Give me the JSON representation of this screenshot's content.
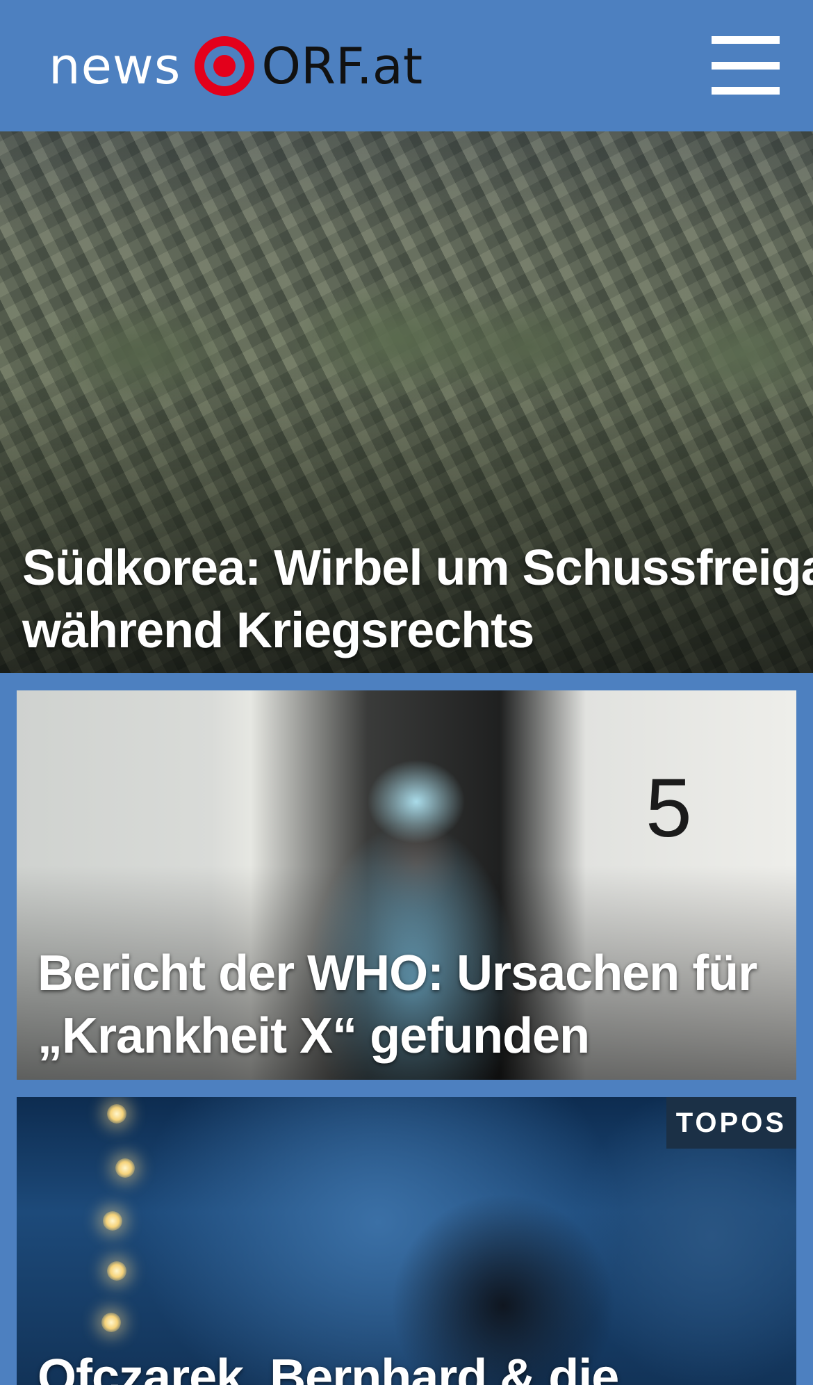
{
  "header": {
    "logo_news": "news",
    "logo_orf": "ORF.at",
    "menu_icon": "hamburger-menu-icon",
    "colors": {
      "background": "#4d80c0",
      "logo_red": "#e3001b"
    }
  },
  "teasers": [
    {
      "title_line1": "Südkorea: Wirbel um Schussfreigabe",
      "title_line2": "während Kriegsrechts"
    },
    {
      "title_line1": "Bericht der WHO: Ursachen für",
      "title_line2": "„Krankheit X“ gefunden",
      "tent_number": "5"
    },
    {
      "title_line1": "Ofczarek, Bernhard & die",
      "badge": "TOPOS"
    }
  ]
}
